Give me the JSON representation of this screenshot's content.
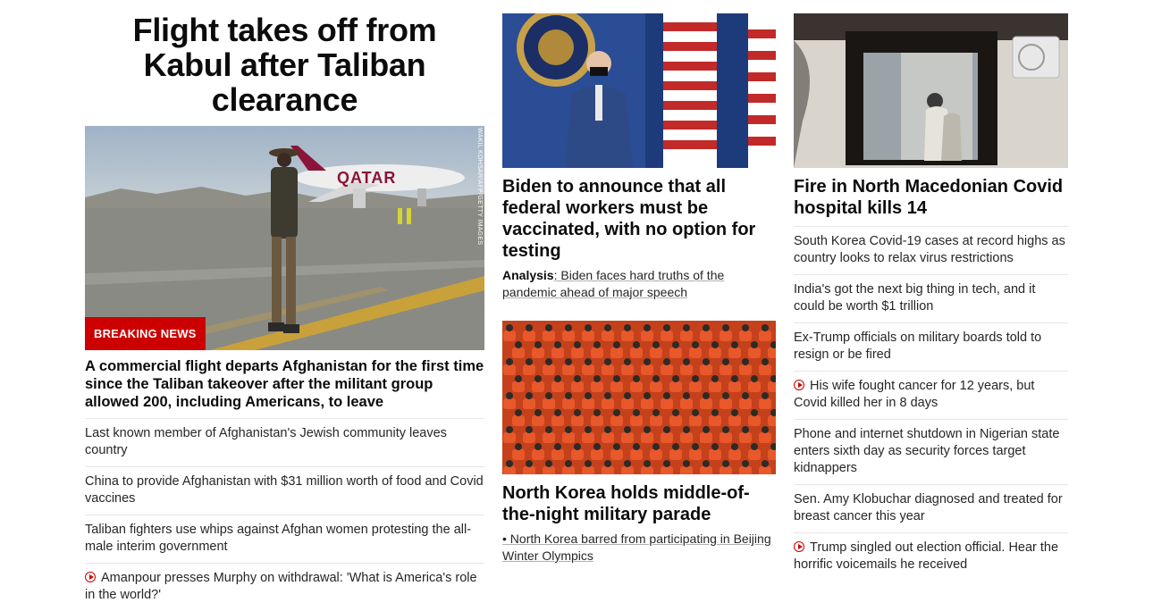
{
  "col1": {
    "title": "Flight takes off from Kabul after Taliban clearance",
    "badge": "BREAKING NEWS",
    "photo_credit": "WAKIL KOHSAR/AFP/GETTY IMAGES",
    "plane_livery": "QATAR",
    "lead_headline": "A commercial flight departs Afghanistan for the first time since the Taliban takeover after the militant group allowed 200, including Americans, to leave",
    "items": [
      {
        "text": "Last known member of Afghanistan's Jewish community leaves country"
      },
      {
        "text": "China to provide Afghanistan with $31 million worth of food and Covid vaccines"
      },
      {
        "text": "Taliban fighters use whips against Afghan women protesting the all-male interim government"
      },
      {
        "text": "Amanpour presses Murphy on withdrawal: 'What is America's role in the world?'",
        "video": true
      }
    ]
  },
  "col2": {
    "story1": {
      "headline": "Biden to announce that all federal workers must be vaccinated, with no option for testing",
      "analysis_label": "Analysis",
      "analysis_text": ": Biden faces hard truths of the pandemic ahead of major speech"
    },
    "story2": {
      "headline": "North Korea holds middle-of-the-night military parade",
      "bullet": "• North Korea barred from participating in Beijing Winter Olympics"
    }
  },
  "col3": {
    "headline": "Fire in North Macedonian Covid hospital kills 14",
    "items": [
      {
        "text": "South Korea Covid-19 cases at record highs as country looks to relax virus restrictions"
      },
      {
        "text": "India's got the next big thing in tech, and it could be worth $1 trillion"
      },
      {
        "text": "Ex-Trump officials on military boards told to resign or be fired"
      },
      {
        "text": "His wife fought cancer for 12 years, but Covid killed her in 8 days",
        "video": true
      },
      {
        "text": "Phone and internet shutdown in Nigerian state enters sixth day as security forces target kidnappers"
      },
      {
        "text": "Sen. Amy Klobuchar diagnosed and treated for breast cancer this year"
      },
      {
        "text": "Trump singled out election official. Hear the horrific voicemails he received",
        "video": true
      }
    ]
  },
  "colors": {
    "breaking_red": "#cc0000",
    "video_icon": "#cc0000",
    "divider": "#e6e6e6"
  }
}
